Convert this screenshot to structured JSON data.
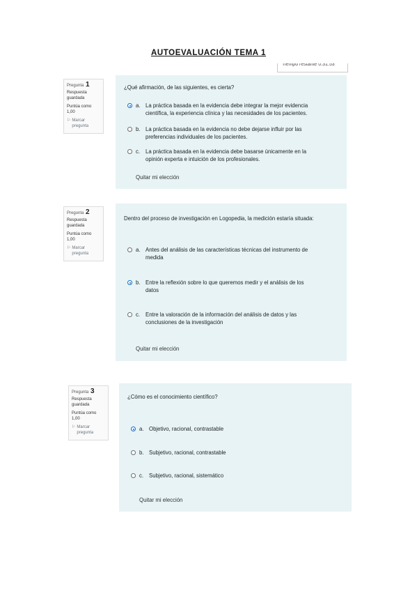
{
  "page_title": "AUTOEVALUACIÓN TEMA 1",
  "timer_text": "Tiempo restante 0:31:53",
  "questions": [
    {
      "label": "Pregunta",
      "number": "1",
      "state": "Respuesta guardada",
      "marks": "Puntúa como 1,00",
      "flag": "Marcar pregunta",
      "text": "¿Qué afirmación, de las siguientes, es cierta?",
      "selected": "a",
      "options": [
        {
          "letter": "a.",
          "line1": "La práctica basada en la evidencia debe integrar la mejor evidencia",
          "line2": "científica, la experiencia clínica y las necesidades de los pacientes."
        },
        {
          "letter": "b.",
          "line1": "La práctica basada en la evidencia no debe dejarse influir por las",
          "line2": "preferencias individuales de los pacientes."
        },
        {
          "letter": "c.",
          "line1": "La práctica basada en la evidencia debe basarse únicamente en la",
          "line2": "opinión experta e intuición de los profesionales."
        }
      ],
      "clear": "Quitar mi elección"
    },
    {
      "label": "Pregunta",
      "number": "2",
      "state": "Respuesta guardada",
      "marks": "Puntúa como 1,00",
      "flag": "Marcar pregunta",
      "text": "Dentro del proceso de investigación en Logopedia, la medición estaría situada:",
      "selected": "b",
      "options": [
        {
          "letter": "a.",
          "line1": "Antes del análisis de las características técnicas del instrumento de",
          "line2": "medida"
        },
        {
          "letter": "b.",
          "line1": "Entre la reflexión sobre lo que queremos medir y el análisis de los",
          "line2": "datos"
        },
        {
          "letter": "c.",
          "line1": "Entre la valoración de la información del análisis de datos y las",
          "line2": "conclusiones de la investigación"
        }
      ],
      "clear": "Quitar mi elección"
    },
    {
      "label": "Pregunta",
      "number": "3",
      "state": "Respuesta guardada",
      "marks": "Puntúa como 1,00",
      "flag": "Marcar pregunta",
      "text": "¿Cómo es el conocimiento científico?",
      "selected": "a",
      "options": [
        {
          "letter": "a.",
          "line1": "Objetivo, racional, contrastable"
        },
        {
          "letter": "b.",
          "line1": "Subjetivo, racional, contrastable"
        },
        {
          "letter": "c.",
          "line1": "Subjetivo, racional, sistemático"
        }
      ],
      "clear": "Quitar mi elección"
    }
  ],
  "colors": {
    "question_bg": "#e7f3f5",
    "radio_selected": "#0f6cbf",
    "info_bg": "#fafafa"
  },
  "icons": {
    "flag": "flag-icon"
  }
}
